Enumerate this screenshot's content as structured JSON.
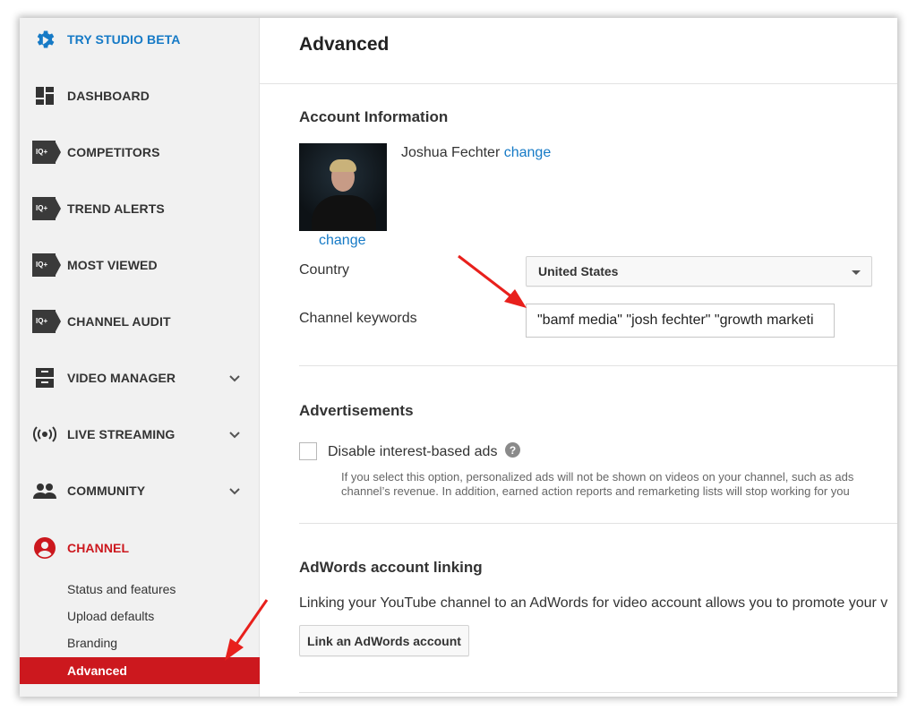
{
  "sidebar": {
    "items": [
      {
        "label": "TRY STUDIO BETA",
        "icon": "gear-icon"
      },
      {
        "label": "DASHBOARD",
        "icon": "dashboard-icon"
      },
      {
        "label": "COMPETITORS",
        "icon": "iq-icon"
      },
      {
        "label": "TREND ALERTS",
        "icon": "iq-icon"
      },
      {
        "label": "MOST VIEWED",
        "icon": "iq-icon"
      },
      {
        "label": "CHANNEL AUDIT",
        "icon": "iq-icon"
      },
      {
        "label": "VIDEO MANAGER",
        "icon": "video-manager-icon"
      },
      {
        "label": "LIVE STREAMING",
        "icon": "live-streaming-icon"
      },
      {
        "label": "COMMUNITY",
        "icon": "community-icon"
      },
      {
        "label": "CHANNEL",
        "icon": "channel-icon"
      }
    ],
    "iq_badge": "IQ+",
    "subitems": [
      {
        "label": "Status and features"
      },
      {
        "label": "Upload defaults"
      },
      {
        "label": "Branding"
      },
      {
        "label": "Advanced"
      }
    ]
  },
  "page": {
    "title": "Advanced",
    "account_info": {
      "heading": "Account Information",
      "name": "Joshua Fechter",
      "change_name": "change",
      "change_avatar": "change",
      "country_label": "Country",
      "country_value": "United States",
      "keywords_label": "Channel keywords",
      "keywords_value": "\"bamf media\" \"josh fechter\" \"growth marketi"
    },
    "ads": {
      "heading": "Advertisements",
      "checkbox_label": "Disable interest-based ads",
      "help": "?",
      "desc_line1": "If you select this option, personalized ads will not be shown on videos on your channel, such as ads",
      "desc_line2": "channel’s revenue. In addition, earned action reports and remarketing lists will stop working for you"
    },
    "adwords": {
      "heading": "AdWords account linking",
      "desc": "Linking your YouTube channel to an AdWords for video account allows you to promote your v",
      "button": "Link an AdWords account"
    }
  },
  "colors": {
    "accent_blue": "#167ac6",
    "accent_red": "#cc181e",
    "annotation_arrow": "#e8201c"
  }
}
